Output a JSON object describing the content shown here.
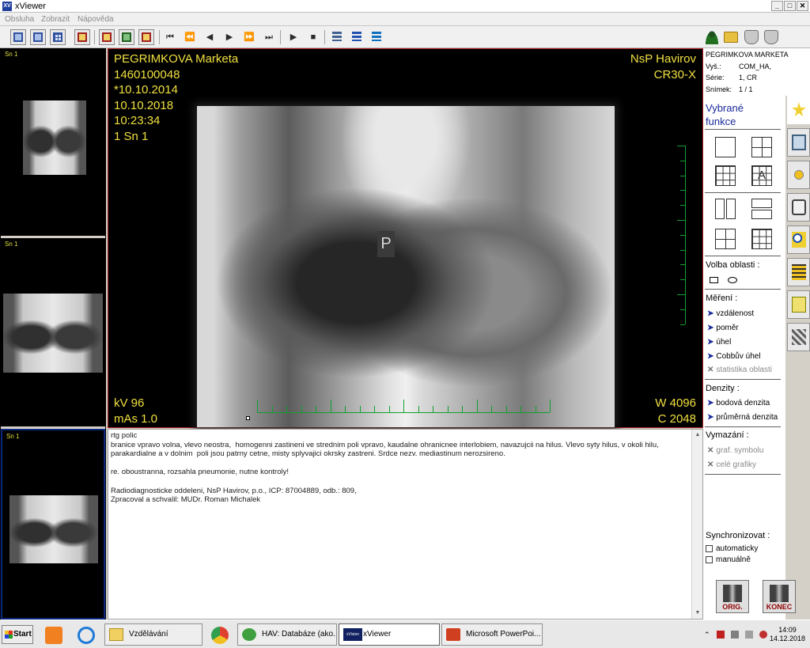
{
  "window": {
    "title": "xViewer",
    "icon_text": "XV",
    "min": "_",
    "max": "□",
    "close": "✕"
  },
  "menu": [
    "Obsluha",
    "Zobrazit",
    "Nápověda"
  ],
  "toolbar_glyphs": {
    "first": "⏮",
    "prev_fast": "⏪",
    "prev": "◀",
    "next": "▶",
    "next_fast": "⏩",
    "last": "⏭",
    "play": "▶",
    "stop": "■"
  },
  "thumbnails": [
    {
      "label": "Sn 1"
    },
    {
      "label": "Sn 1"
    },
    {
      "label": "Sn 1"
    }
  ],
  "viewer": {
    "patient_name": "PEGRIMKOVA Marketa",
    "patient_id": "1460100048",
    "birth_date": "*10.10.2014",
    "study_date": "10.10.2018",
    "study_time": "10:23:34",
    "series": "1 Sn 1",
    "institution": "NsP Havirov",
    "modality": "CR30-X",
    "kv": "kV 96",
    "mas": "mAs 1.0",
    "window_w": "W 4096",
    "window_c": "C 2048",
    "marker": "P"
  },
  "report": {
    "text": "rtg polic\nbranice vpravo volna, vlevo neostra,  homogenni zastineni ve strednim poli vpravo, kaudalne ohranicnee interlobiem, navazujcii na hilus. Vlevo syty hilus, v okoli hilu,\nparakardialne a v dolnim  poli jsou patrny cetne, misty splyvajici okrsky zastreni. Srdce nezv. mediastinum nerozsireno.\n\nre. oboustranna, rozsahla pneumonie, nutne kontroly!\n\nRadiodiagnosticke oddeleni, NsP Havirov, p.o., ICP: 87004889, odb.: 809,\nZpracoval a schvalil: MUDr. Roman Michalek"
  },
  "info": {
    "name": "PEGRIMKOVA MARKETA",
    "rows": [
      {
        "label": "Vyš.:",
        "value": "COM_HA,"
      },
      {
        "label": "Série:",
        "value": "1, CR"
      },
      {
        "label": "Snímek:",
        "value": "1 / 1"
      }
    ]
  },
  "functions": {
    "title_1": "Vybrané",
    "title_2": "funkce",
    "region_title": "Volba oblasti :",
    "measure_title": "Měření :",
    "measure_items": [
      "vzdálenost",
      "poměr",
      "úhel",
      "Cobbův úhel"
    ],
    "measure_disabled": "statistika oblasti",
    "density_title": "Denzity :",
    "density_items": [
      "bodová denzita",
      "průměrná denzita"
    ],
    "delete_title": "Vymazání :",
    "delete_items": [
      "graf. symbolu",
      "celé grafiky"
    ],
    "sync_title": "Synchronizovat :",
    "sync_items": [
      "automaticky",
      "manuálně"
    ],
    "arrow": "➤",
    "cross": "✕",
    "orig_label": "ORIG.",
    "konec_label": "KONEC"
  },
  "taskbar": {
    "start": "Start",
    "tasks": [
      "Vzdělávání",
      "HAV: Databáze (ako...",
      "xViewer",
      "Microsoft PowerPoi..."
    ],
    "task_icon_text": "xVision",
    "time": "14:09",
    "date": "14.12.2018"
  },
  "colors": {
    "overlay": "#f0e040",
    "scale": "#10a030",
    "accent": "#1a2a9a"
  }
}
